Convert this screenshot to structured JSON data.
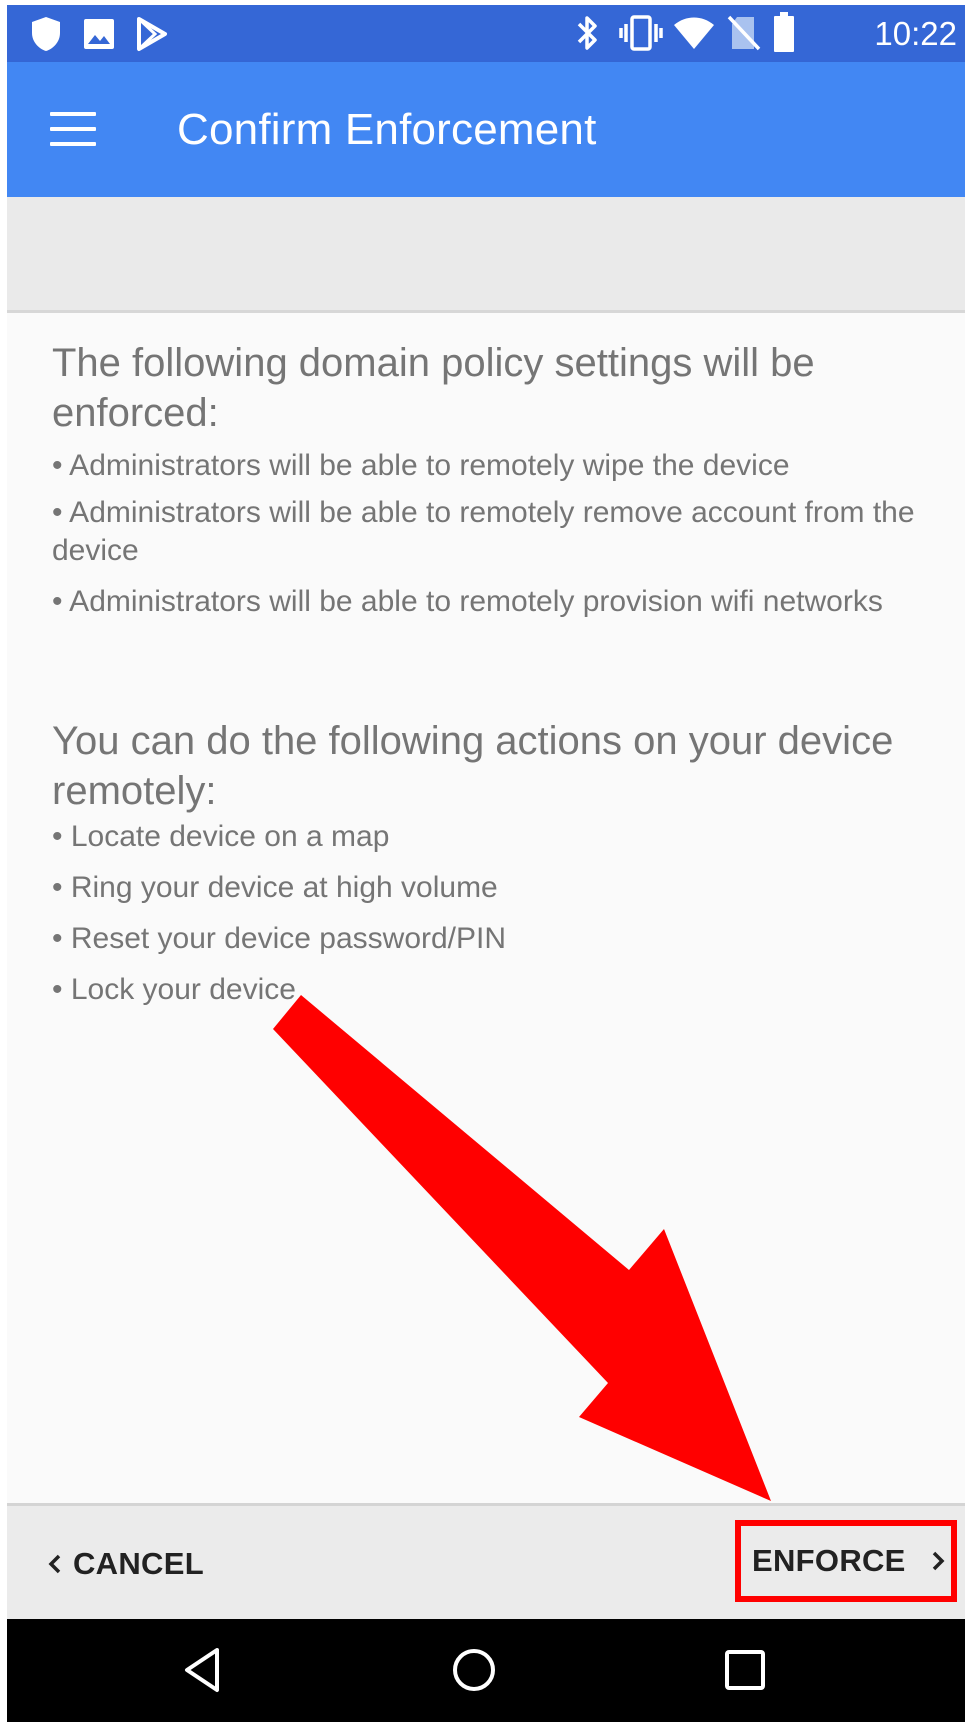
{
  "status_bar": {
    "time": "10:22",
    "left_icons": [
      "shield-icon",
      "image-icon",
      "play-store-icon"
    ],
    "right_icons": [
      "bluetooth-icon",
      "vibrate-icon",
      "wifi-icon",
      "no-sim-icon",
      "battery-icon"
    ]
  },
  "app_bar": {
    "title": "Confirm Enforcement",
    "menu_icon": "hamburger-menu-icon"
  },
  "content": {
    "section1": {
      "heading": "The following domain policy settings will be enforced:",
      "bullets": [
        "• Administrators will be able to remotely wipe the device",
        "• Administrators will be able to remotely remove account from the device",
        "• Administrators will be able to remotely provision wifi networks"
      ]
    },
    "section2": {
      "heading": "You can do the following actions on your device remotely:",
      "bullets": [
        "• Locate device on a map",
        "• Ring your device at high volume",
        "• Reset your device password/PIN",
        "• Lock your device"
      ]
    }
  },
  "bottom_bar": {
    "cancel_label": "CANCEL",
    "enforce_label": "ENFORCE"
  },
  "nav_bar": {
    "buttons": [
      "back-icon",
      "home-icon",
      "recents-icon"
    ]
  },
  "annotation": {
    "arrow_color": "#ff0000",
    "highlight_color": "#ff0000"
  },
  "colors": {
    "status_bar": "#3567d6",
    "app_bar": "#4287f3",
    "text_gray": "#757575"
  }
}
